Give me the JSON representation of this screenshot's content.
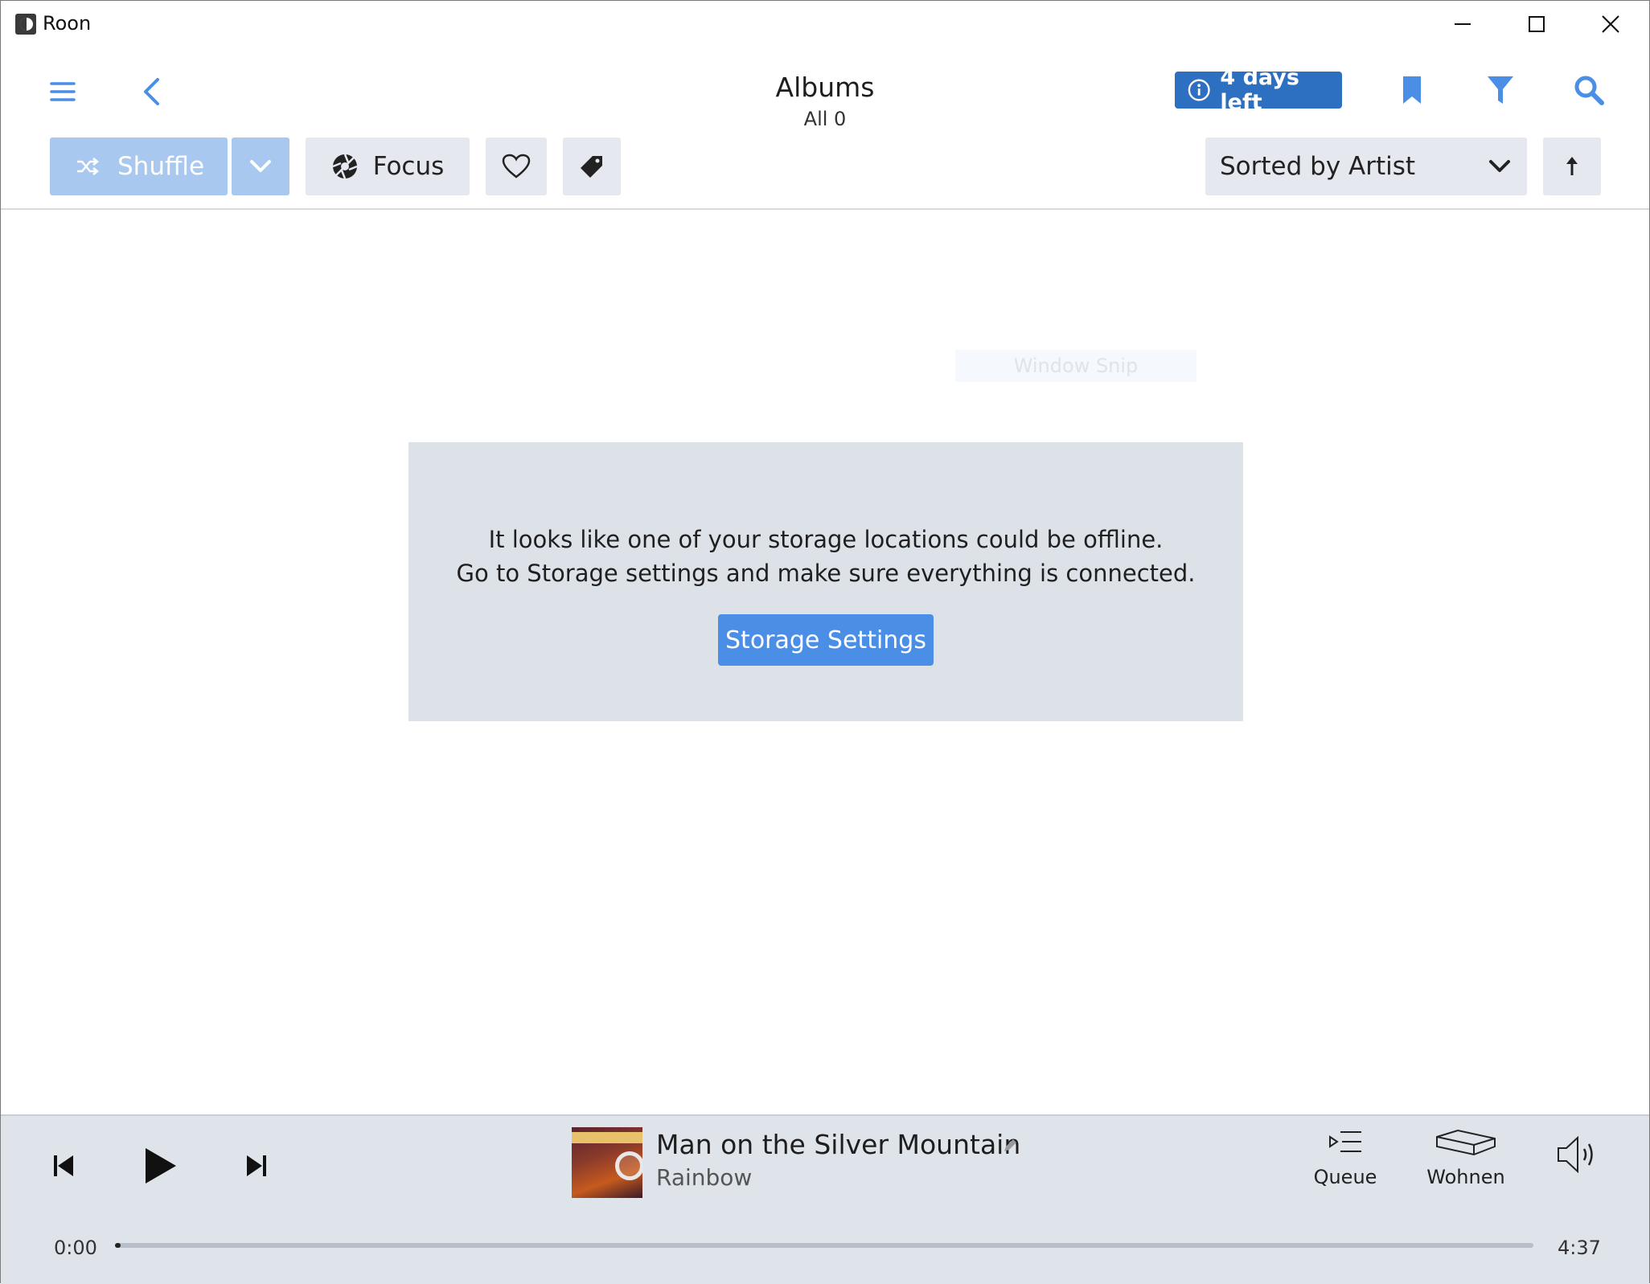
{
  "window": {
    "title": "Roon"
  },
  "header": {
    "title": "Albums",
    "subtitle": "All 0",
    "trial_badge": "4 days left"
  },
  "toolbar": {
    "shuffle_label": "Shuffle",
    "focus_label": "Focus",
    "sort_label": "Sorted by Artist"
  },
  "overlay": {
    "snip_label": "Window Snip"
  },
  "message": {
    "line1": "It looks like one of your storage locations could be offline.",
    "line2": "Go to Storage settings and make sure everything is connected.",
    "button_label": "Storage Settings"
  },
  "now_playing": {
    "track_title": "Man on the Silver Mountain",
    "artist": "Rainbow",
    "elapsed": "0:00",
    "duration": "4:37",
    "progress_fraction": 0.004,
    "queue_label": "Queue",
    "zone_label": "Wohnen"
  },
  "colors": {
    "accent": "#4a8ee6",
    "badge": "#2d6fc1",
    "shuffle_disabled": "#a8c8f0",
    "player_bg": "#dfe3ea"
  },
  "icons": [
    "menu-icon",
    "back-icon",
    "bookmark-icon",
    "filter-icon",
    "search-icon",
    "shuffle-icon",
    "chevron-down-icon",
    "focus-icon",
    "heart-icon",
    "tag-icon",
    "sort-direction-icon",
    "previous-icon",
    "play-icon",
    "next-icon",
    "queue-icon",
    "zone-device-icon",
    "volume-icon",
    "edit-icon"
  ]
}
